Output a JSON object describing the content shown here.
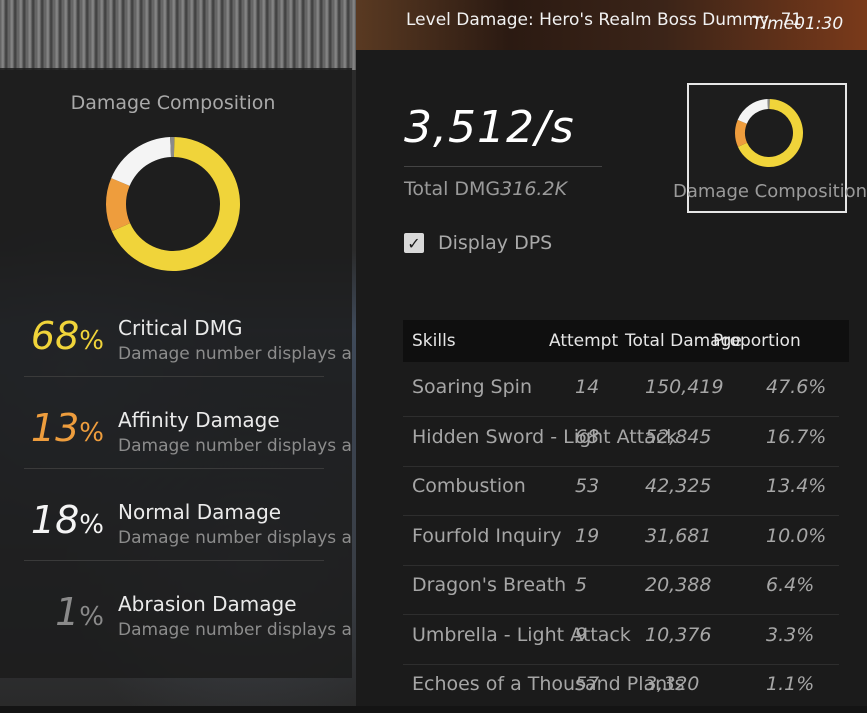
{
  "header": {
    "title": "Level Damage: Hero's Realm Boss Dummy",
    "level_suffix": "71",
    "timer_label": "Time",
    "timer_value": "01:30"
  },
  "composition": {
    "title": "Damage Composition",
    "items": [
      {
        "pct": "68",
        "unit": "%",
        "name": "Critical DMG",
        "desc": "Damage number displays a",
        "color": "#f0d43a",
        "share": 0.68
      },
      {
        "pct": "13",
        "unit": "%",
        "name": "Affinity Damage",
        "desc": "Damage number displays a",
        "color": "#ee9d3d",
        "share": 0.13
      },
      {
        "pct": "18",
        "unit": "%",
        "name": "Normal Damage",
        "desc": "Damage number displays a",
        "color": "#f4f4f4",
        "share": 0.18
      },
      {
        "pct": "1",
        "unit": "%",
        "name": "Abrasion Damage",
        "desc": "Damage number displays a",
        "color": "#8a8a8a",
        "share": 0.01
      }
    ]
  },
  "summary": {
    "dps": "3,512/s",
    "total_label": "Total DMG",
    "total_value": "316.2K",
    "display_dps_label": "Display DPS",
    "display_dps_checked": true,
    "composition_button_label": "Damage Composition"
  },
  "table": {
    "headers": [
      "Skills",
      "Attempt",
      "Total Damage",
      "Proportion"
    ],
    "rows": [
      {
        "skill": "Soaring Spin",
        "attempt": "14",
        "total": "150,419",
        "proportion": "47.6%"
      },
      {
        "skill": "Hidden Sword - Light Attack",
        "attempt": "68",
        "total": "52,845",
        "proportion": "16.7%"
      },
      {
        "skill": "Combustion",
        "attempt": "53",
        "total": "42,325",
        "proportion": "13.4%"
      },
      {
        "skill": "Fourfold Inquiry",
        "attempt": "19",
        "total": "31,681",
        "proportion": "10.0%"
      },
      {
        "skill": "Dragon's Breath",
        "attempt": "5",
        "total": "20,388",
        "proportion": "6.4%"
      },
      {
        "skill": "Umbrella - Light Attack",
        "attempt": "9",
        "total": "10,376",
        "proportion": "3.3%"
      },
      {
        "skill": "Echoes of a Thousand Plants",
        "attempt": "57",
        "total": "3,320",
        "proportion": "1.1%"
      }
    ]
  }
}
